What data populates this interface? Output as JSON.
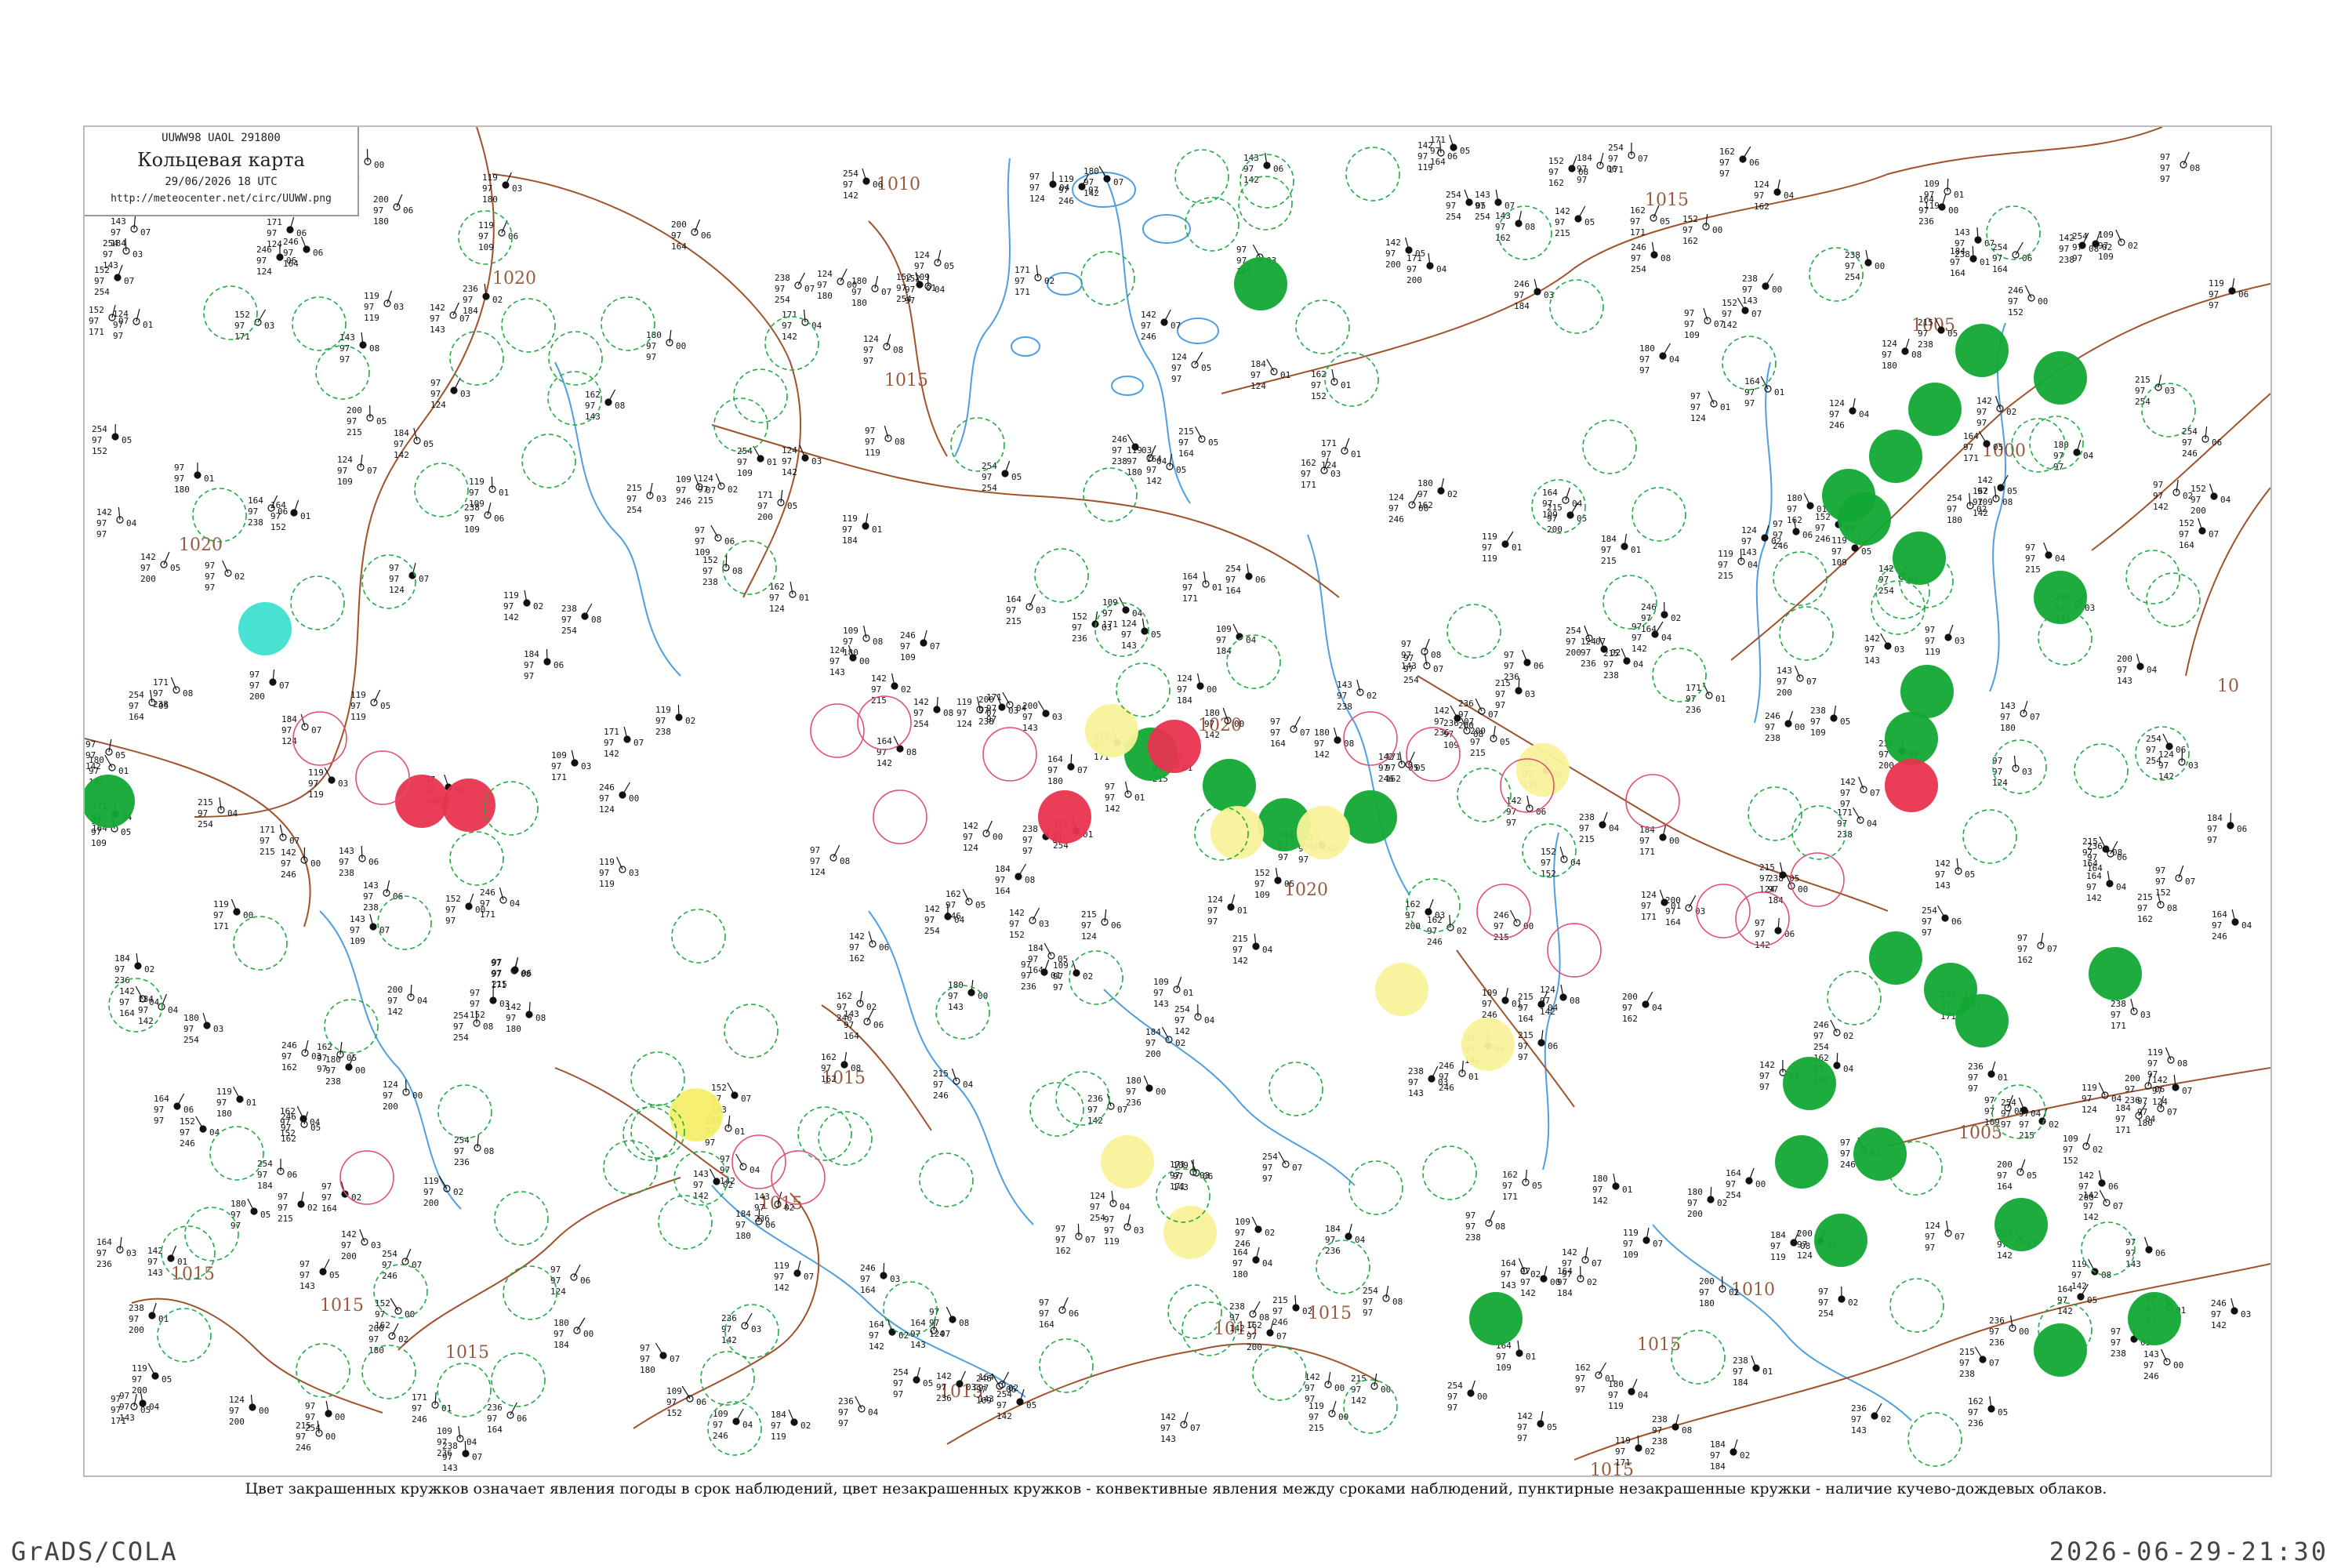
{
  "header": {
    "code_line": "UUWW98  UAOL  291800",
    "title": "Кольцевая карта",
    "date": "29/06/2026 18 UTC",
    "url": "http://meteocenter.net/circ/UUWW.png"
  },
  "caption": "Цвет закрашенных кружков означает явления погоды в срок наблюдений, цвет незакрашенных кружков - конвективные явления между сроками наблюдений, пунктирные незакрашенные кружки - наличие кучево-дождевых облаков.",
  "footer": {
    "left": "GrADS/COLA",
    "right": "2026-06-29-21:30"
  },
  "colors": {
    "isobar": "#a0522d",
    "river": "#4f9fe0",
    "storm_green": "#11a833",
    "rain_red": "#e8334f",
    "fog_yellow": "#f5ef6a",
    "haze_yellow": "#f9f29a",
    "snow_cyan": "#3ee0d0",
    "dashed_green": "#22aa44",
    "pink_ring": "#e05070"
  },
  "isobar_labels": [
    {
      "text": "1010"
    },
    {
      "text": "1020"
    },
    {
      "text": "1015"
    },
    {
      "text": "1015"
    },
    {
      "text": "1015"
    },
    {
      "text": "1005"
    },
    {
      "text": "1000"
    },
    {
      "text": "10"
    },
    {
      "text": "1020"
    },
    {
      "text": "1020"
    },
    {
      "text": "1020"
    },
    {
      "text": "1015"
    },
    {
      "text": "1015"
    },
    {
      "text": "1015"
    },
    {
      "text": "1015"
    },
    {
      "text": "1015"
    },
    {
      "text": "1015"
    },
    {
      "text": "1015"
    },
    {
      "text": "1010"
    },
    {
      "text": "1005"
    },
    {
      "text": "1015"
    },
    {
      "text": "1015"
    }
  ],
  "sample_readings": [
    "164",
    "97",
    "109",
    "200",
    "142",
    "246",
    "238",
    "236",
    "162",
    "143",
    "215",
    "180",
    "152",
    "97",
    "119",
    "184",
    "97",
    "124",
    "171",
    "142",
    "254"
  ]
}
